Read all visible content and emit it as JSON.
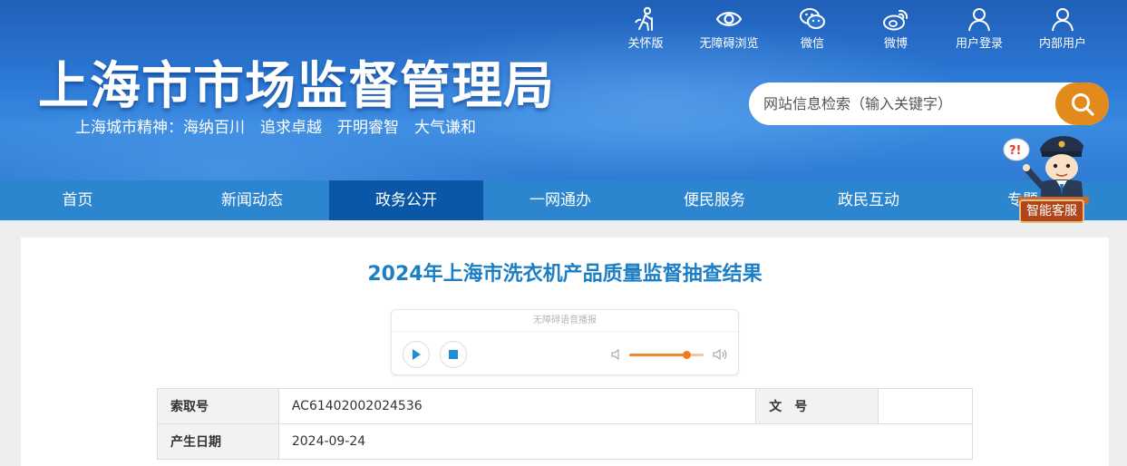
{
  "header": {
    "site_title": "上海市市场监督管理局",
    "slogan": "上海城市精神：海纳百川　追求卓越　开明睿智　大气谦和",
    "top_links": [
      {
        "label": "关怀版",
        "icon": "elderly-care-icon"
      },
      {
        "label": "无障碍浏览",
        "icon": "eye-icon"
      },
      {
        "label": "微信",
        "icon": "wechat-icon"
      },
      {
        "label": "微博",
        "icon": "weibo-icon"
      },
      {
        "label": "用户登录",
        "icon": "user-icon"
      },
      {
        "label": "内部用户",
        "icon": "user-icon"
      }
    ],
    "search": {
      "placeholder": "网站信息检索（输入关键字）",
      "icon": "search-icon"
    }
  },
  "nav": {
    "items": [
      "首页",
      "新闻动态",
      "政务公开",
      "一网通办",
      "便民服务",
      "政民互动",
      "专题"
    ],
    "active": "政务公开"
  },
  "mascot": {
    "label": "智能客服",
    "bubble": "?!"
  },
  "article": {
    "title": "2024年上海市洗衣机产品质量监督抽查结果",
    "player": {
      "title": "无障碍语音播报",
      "volume_fraction": 0.78
    },
    "meta": {
      "index_label": "索取号",
      "index_value": "AC61402002024536",
      "doc_label": "文　号",
      "doc_value": "",
      "date_label": "产生日期",
      "date_value": "2024-09-24"
    }
  },
  "colors": {
    "nav_bg": "#2b86cf",
    "nav_active": "#0a56a7",
    "title_blue": "#1c7fc6",
    "search_btn": "#e28a1c"
  }
}
